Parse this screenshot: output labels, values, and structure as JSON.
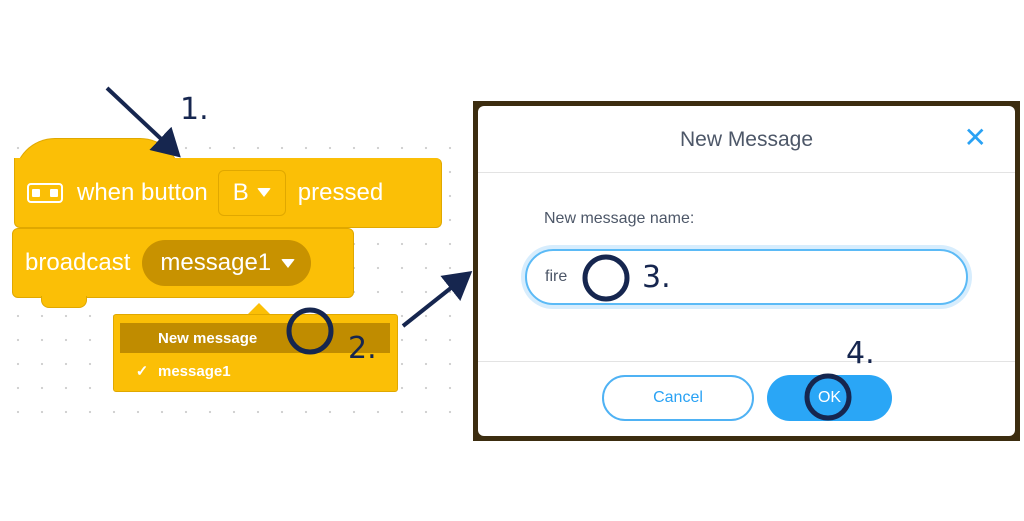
{
  "workspace": {
    "hat_block": {
      "label_prefix": "when button",
      "dropdown_value": "B",
      "label_suffix": "pressed",
      "icon": "gamepad-icon"
    },
    "broadcast_block": {
      "label": "broadcast",
      "message_value": "message1"
    },
    "dropdown_menu": {
      "items": [
        "New message",
        "message1"
      ],
      "checked_item": "message1",
      "check_glyph": "✓"
    }
  },
  "dialog": {
    "title": "New Message",
    "close_glyph": "✕",
    "field_label": "New message name:",
    "field_value": "fire",
    "cancel_label": "Cancel",
    "ok_label": "OK"
  },
  "annotations": {
    "step_1": "1.",
    "step_2": "2.",
    "step_3": "3.",
    "step_4": "4."
  },
  "colors": {
    "block_yellow": "#fbbf06",
    "block_dark": "#c89200",
    "accent_blue": "#2aa6f6",
    "annotation_navy": "#16264f"
  }
}
